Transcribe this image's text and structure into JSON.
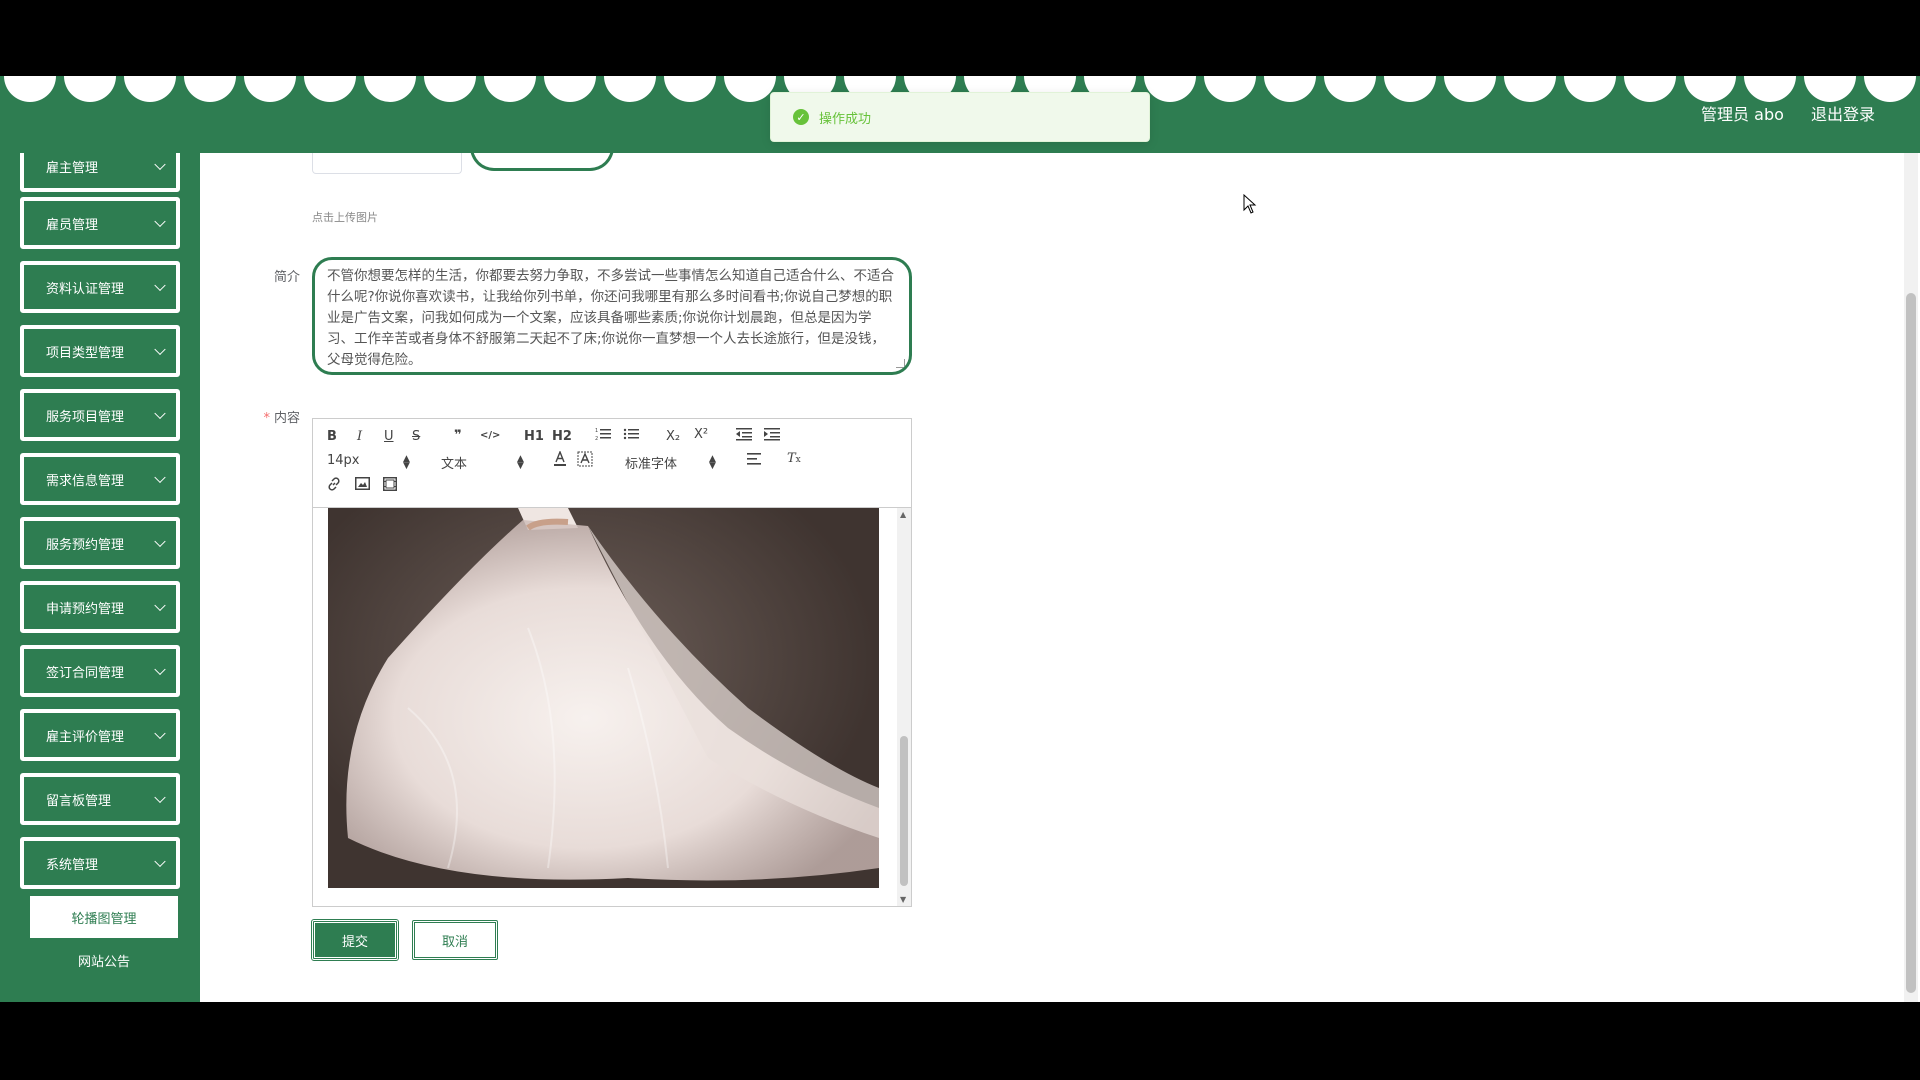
{
  "header": {
    "user_label": "管理员 abo",
    "logout_label": "退出登录",
    "color": "#2e7d51"
  },
  "toast": {
    "icon": "check-circle-icon",
    "message": "操作成功"
  },
  "sidebar": {
    "items": [
      {
        "label": "雇主管理"
      },
      {
        "label": "雇员管理"
      },
      {
        "label": "资料认证管理"
      },
      {
        "label": "项目类型管理"
      },
      {
        "label": "服务项目管理"
      },
      {
        "label": "需求信息管理"
      },
      {
        "label": "服务预约管理"
      },
      {
        "label": "申请预约管理"
      },
      {
        "label": "签订合同管理"
      },
      {
        "label": "雇主评价管理"
      },
      {
        "label": "留言板管理"
      },
      {
        "label": "系统管理"
      }
    ],
    "sub_items": [
      {
        "label": "轮播图管理"
      },
      {
        "label": "网站公告"
      }
    ]
  },
  "form": {
    "upload_hint": "点击上传图片",
    "intro_label": "简介",
    "intro_text": "不管你想要怎样的生活，你都要去努力争取，不多尝试一些事情怎么知道自己适合什么、不适合什么呢?你说你喜欢读书，让我给你列书单，你还问我哪里有那么多时间看书;你说自己梦想的职业是广告文案，问我如何成为一个文案，应该具备哪些素质;你说你计划晨跑，但总是因为学习、工作辛苦或者身体不舒服第二天起不了床;你说你一直梦想一个人去长途旅行，但是没钱，父母觉得危险。",
    "content_label": "内容",
    "submit_label": "提交",
    "cancel_label": "取消"
  },
  "editor": {
    "toolbar_row1": [
      "B",
      "I",
      "U",
      "S",
      "❞",
      "</>",
      "H1",
      "H2",
      "ordered-list-icon",
      "bullet-list-icon",
      "X₂",
      "X²",
      "outdent-icon",
      "indent-icon"
    ],
    "font_size": "14px",
    "header_select": "文本",
    "font_family": "标准字体",
    "toolbar_row3": [
      "link-icon",
      "image-icon",
      "video-icon"
    ]
  }
}
